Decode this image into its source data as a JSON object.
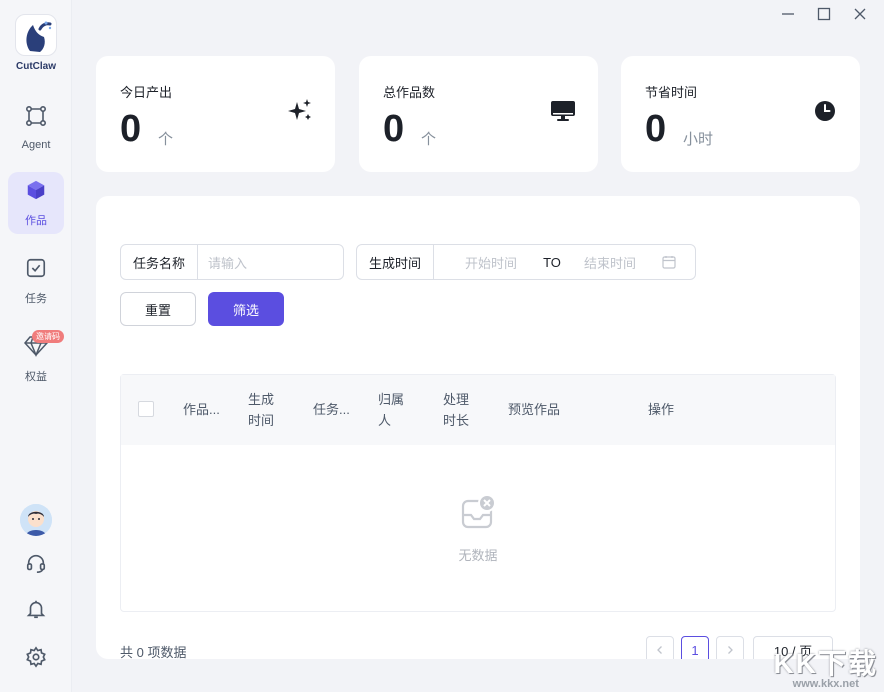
{
  "app": {
    "name": "CutClaw"
  },
  "sidebar": {
    "items": [
      {
        "label": "Agent",
        "icon": "agent-nodes-icon"
      },
      {
        "label": "作品",
        "icon": "cube-icon"
      },
      {
        "label": "任务",
        "icon": "task-check-icon"
      },
      {
        "label": "权益",
        "icon": "diamond-icon",
        "badge": "邀请码"
      }
    ],
    "bottom_icons": [
      "avatar",
      "headset-icon",
      "bell-icon",
      "gear-icon"
    ]
  },
  "stats": [
    {
      "title": "今日产出",
      "value": "0",
      "unit": "个",
      "icon": "sparkles-icon"
    },
    {
      "title": "总作品数",
      "value": "0",
      "unit": "个",
      "icon": "monitor-icon"
    },
    {
      "title": "节省时间",
      "value": "0",
      "unit": "小时",
      "icon": "clock-icon"
    }
  ],
  "filters": {
    "task_name_label": "任务名称",
    "task_name_placeholder": "请输入",
    "time_label": "生成时间",
    "start_placeholder": "开始时间",
    "to_label": "TO",
    "end_placeholder": "结束时间",
    "reset_label": "重置",
    "filter_label": "筛选"
  },
  "table": {
    "columns": [
      "作品...",
      "生成\n时间",
      "任务...",
      "归属\n人",
      "处理\n时长",
      "预览作品",
      "操作"
    ],
    "empty_text": "无数据"
  },
  "pagination": {
    "total_text": "共 0 项数据",
    "current_page": "1",
    "page_size": "10 / 页"
  },
  "watermark": {
    "big": "KK下载",
    "small": "www.kkx.net"
  },
  "colors": {
    "accent": "#5b4ee0",
    "active_nav_bg": "#e6e6fb",
    "badge": "#f07c7c"
  }
}
